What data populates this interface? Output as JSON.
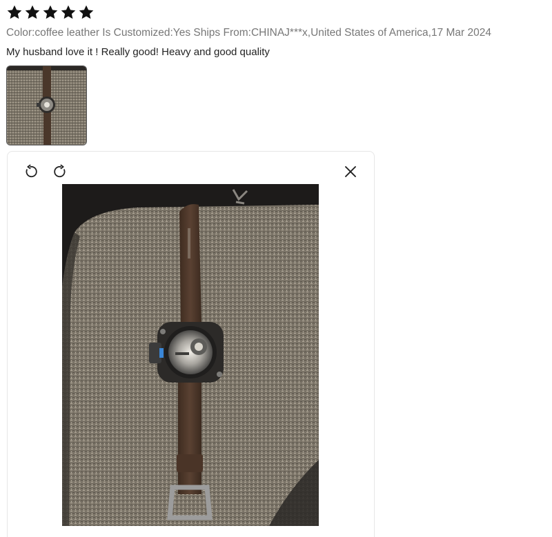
{
  "review": {
    "rating": 5,
    "rating_max": 5,
    "meta": "Color:coffee leather Is Customized:Yes Ships From:CHINAJ***x,United States of America,17 Mar 2024",
    "comment": "My husband love it ! Really good! Heavy and good quality",
    "photos": [
      {
        "type": "photo",
        "subject": "brown leather strap wristwatch on gray fabric"
      }
    ]
  },
  "viewer": {
    "icons": {
      "rotate_left": "rotate-left-icon",
      "rotate_right": "rotate-right-icon",
      "close": "close-icon"
    }
  },
  "colors": {
    "star": "#111111",
    "meta_text": "#777777",
    "comment_text": "#222222",
    "viewer_border": "#e6e6e6"
  }
}
